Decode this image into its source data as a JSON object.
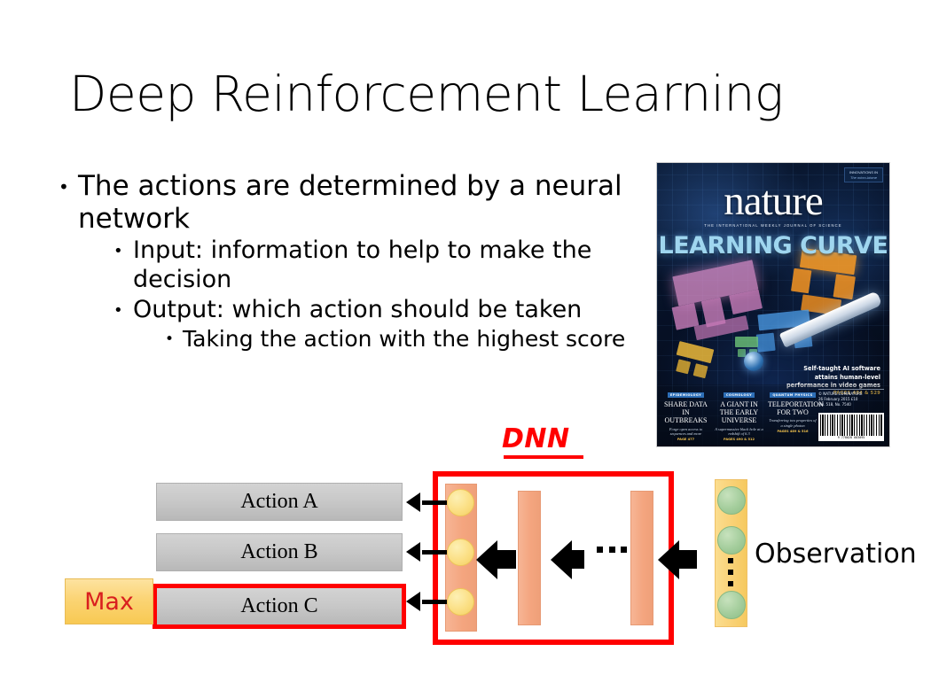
{
  "slide": {
    "title": "Deep Reinforcement Learning",
    "background_color": "#ffffff"
  },
  "bullets": [
    {
      "level": 1,
      "marker": "•",
      "text": "The actions are determined by a neural network"
    },
    {
      "level": 2,
      "marker": "•",
      "text": "Input: information to help to make the decision"
    },
    {
      "level": 2,
      "marker": "•",
      "text": "Output: which action should be taken"
    },
    {
      "level": 3,
      "marker": "•",
      "text": "Taking the action with the highest score"
    }
  ],
  "nature_cover": {
    "masthead": "nature",
    "strapline": "THE INTERNATIONAL WEEKLY JOURNAL OF SCIENCE",
    "badge_line1": "INNOVATIONS IN",
    "badge_line2": "The micro-biome",
    "headline": "LEARNING CURVE",
    "blurb_line1": "Self-taught AI software",
    "blurb_line2": "attains human-level",
    "blurb_line3": "performance in video games",
    "blurb_pages": "PAGES 484 & 529",
    "imprint_line1": "© NATURE.COM/NATURE",
    "imprint_line2": "26 February 2015   £10",
    "imprint_line3": "Vol. 518, No. 7540",
    "barcode_number": "9 770028 083095",
    "teasers": [
      {
        "kicker": "EPIDEMIOLOGY",
        "title": "SHARE DATA IN OUTBREAKS",
        "subtitle": "Forge open access to sequences and more",
        "page": "PAGE 477"
      },
      {
        "kicker": "COSMOLOGY",
        "title": "A GIANT IN THE EARLY UNIVERSE",
        "subtitle": "A supermassive black hole at a redshift of 6.3",
        "page": "PAGES 490 & 512"
      },
      {
        "kicker": "QUANTUM PHYSICS",
        "title": "TELEPORTATION FOR TWO",
        "subtitle": "Transferring two properties of a single photon",
        "page": "PAGES 489 & 516"
      }
    ]
  },
  "diagram": {
    "dnn_label": "DNN",
    "observation_label": "Observation",
    "max_label": "Max",
    "actions": [
      {
        "label": "Action A",
        "selected": false
      },
      {
        "label": "Action B",
        "selected": false
      },
      {
        "label": "Action C",
        "selected": true
      }
    ],
    "hidden_layer_ellipsis": "...",
    "observation_ellipsis": "⋮",
    "colors": {
      "dnn_border": "#ff0000",
      "dnn_label": "#ff0000",
      "layer_bar": "#f4a57f",
      "output_node": "#fbdf84",
      "observation_bar": "#f9d175",
      "observation_node": "#a4cd9c",
      "action_box": "#c8c8c8",
      "max_box": "#fbd474",
      "max_text": "#d91f1f",
      "arrow": "#000000"
    }
  }
}
